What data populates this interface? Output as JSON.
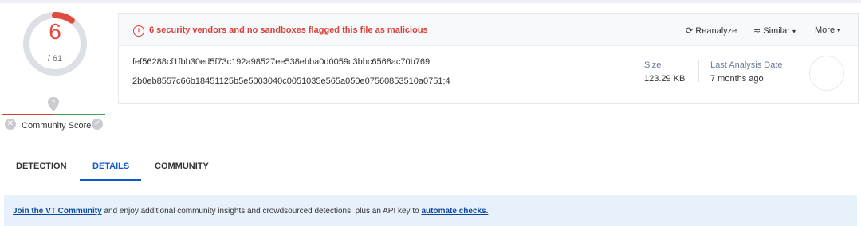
{
  "score": {
    "detections": "6",
    "total": "/ 61",
    "detected_count": 6,
    "engine_count": 61,
    "ring_colors": {
      "detected": "#e04a3f",
      "track": "#dcdfe3"
    }
  },
  "community": {
    "label": "Community Score",
    "marker_icon": "location-pin-icon",
    "negative_icon": "close-icon",
    "positive_icon": "check-icon"
  },
  "alert": {
    "icon": "alert-circle-icon",
    "message": "6 security vendors and no sandboxes flagged this file as malicious",
    "color": "#d8403a"
  },
  "actions": {
    "reanalyze": "Reanalyze",
    "reanalyze_icon": "refresh-icon",
    "similar": "Similar",
    "similar_icon": "similar-icon",
    "more": "More"
  },
  "file": {
    "hash_sha256": "fef56288cf1fbb30ed5f73c192a98527ee538ebba0d0059c3bbc6568ac70b769",
    "hash_ssdeep": "2b0eb8557c66b18451125b5e5003040c0051035e565a050e07560853510a0751;4",
    "size_label": "Size",
    "size_value": "123.29 KB",
    "last_analysis_label": "Last Analysis Date",
    "last_analysis_value": "7 months ago"
  },
  "tabs": [
    {
      "label": "DETECTION",
      "active": false
    },
    {
      "label": "DETAILS",
      "active": true
    },
    {
      "label": "COMMUNITY",
      "active": false
    }
  ],
  "banner": {
    "link1": "Join the VT Community",
    "middle": " and enjoy additional community insights and crowdsourced detections, plus an API key to ",
    "link2": "automate checks."
  },
  "colors": {
    "accent": "#0b57d0",
    "danger": "#d8403a",
    "banner_bg": "#e6f1fb"
  }
}
